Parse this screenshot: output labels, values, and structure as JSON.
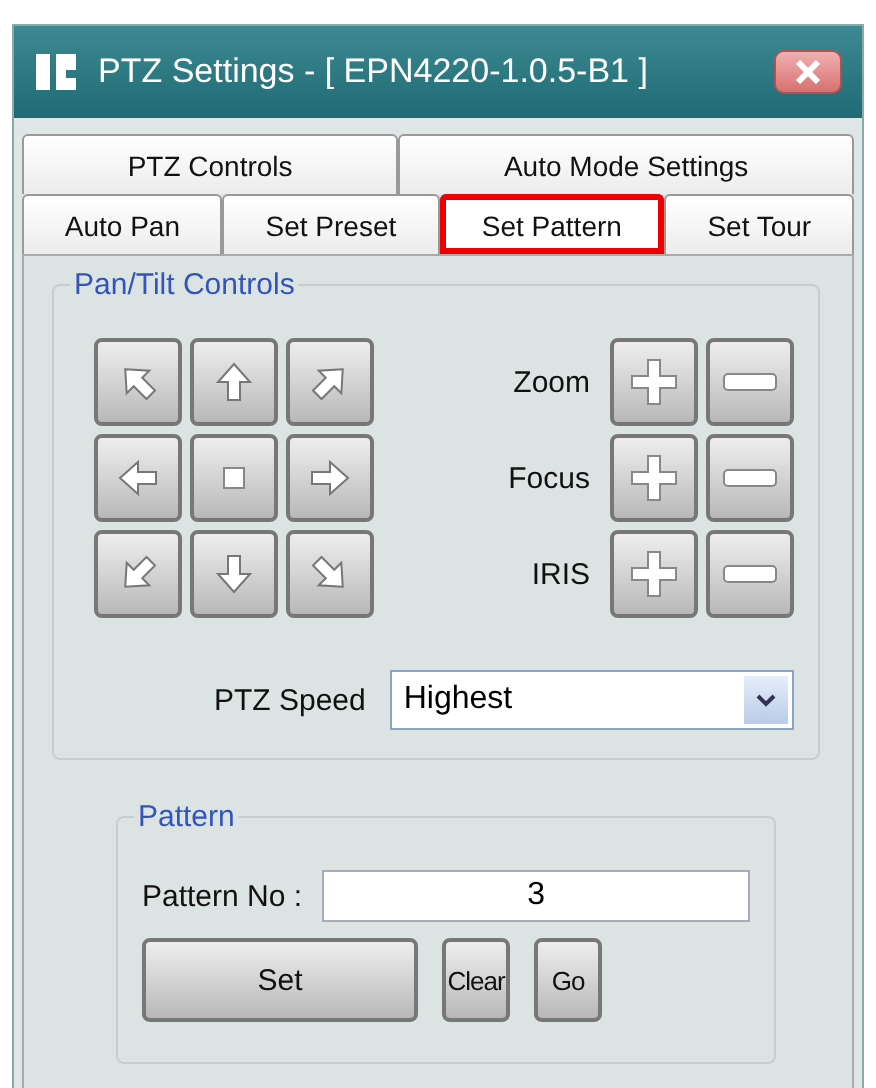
{
  "window": {
    "title": "PTZ Settings - [ EPN4220-1.0.5-B1 ]"
  },
  "tab_rows": [
    [
      {
        "label": "PTZ Controls",
        "selected": false
      },
      {
        "label": "Auto Mode Settings",
        "selected": false
      }
    ],
    [
      {
        "label": "Auto Pan",
        "selected": false
      },
      {
        "label": "Set Preset",
        "selected": false
      },
      {
        "label": "Set Pattern",
        "selected": true
      },
      {
        "label": "Set Tour",
        "selected": false
      }
    ]
  ],
  "pan_tilt": {
    "title": "Pan/Tilt Controls",
    "lens_rows": [
      {
        "label": "Zoom"
      },
      {
        "label": "Focus"
      },
      {
        "label": "IRIS"
      }
    ],
    "speed_label": "PTZ Speed",
    "speed_value": "Highest"
  },
  "pattern": {
    "title": "Pattern",
    "number_label": "Pattern No :",
    "number_value": "3",
    "buttons": [
      "Set",
      "Clear",
      "Go"
    ]
  }
}
